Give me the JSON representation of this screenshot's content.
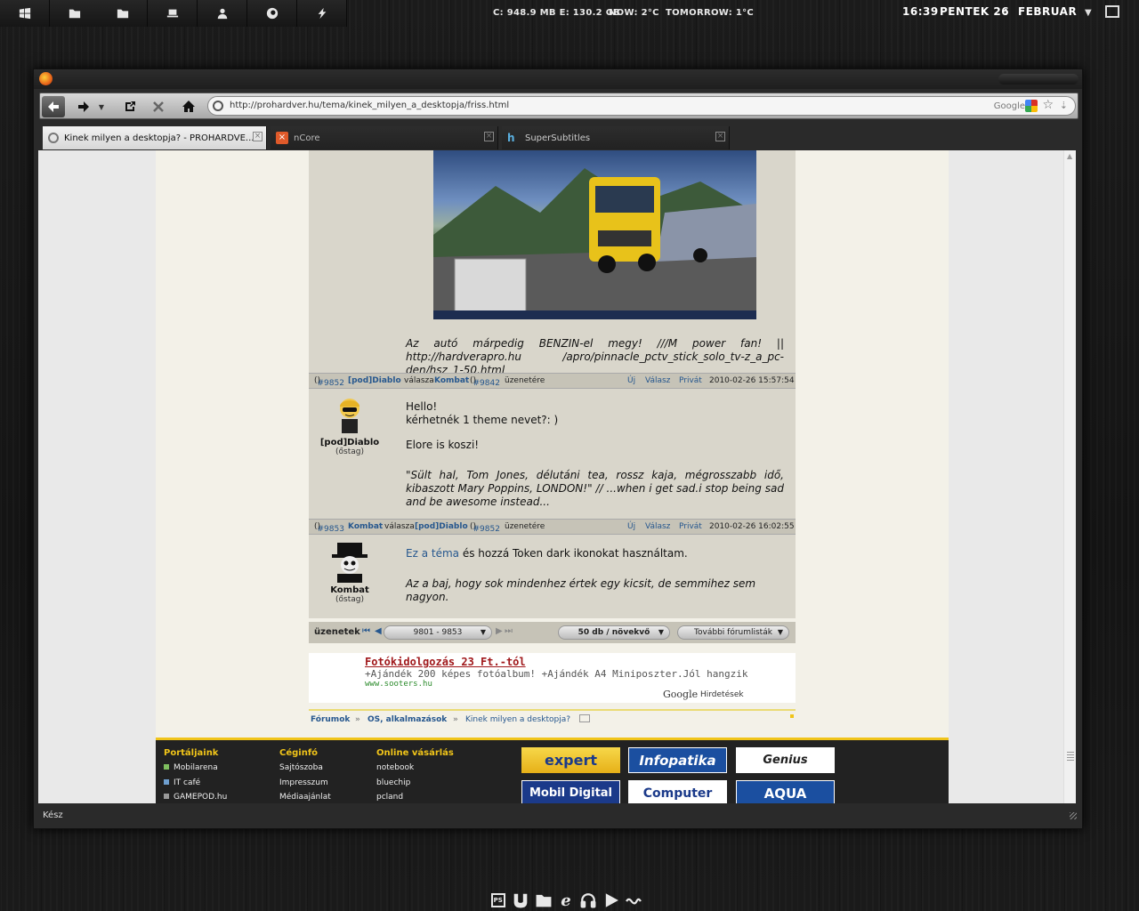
{
  "panel": {
    "stats": "C: 948.9 MB  E: 130.2 GB",
    "weather_now": "NOW:  2°C",
    "weather_tomorrow": "TOMORROW:      1°C",
    "time": "16:39",
    "day": "PENTEK 26",
    "separator": ":",
    "month": "FEBRUAR"
  },
  "browser": {
    "url": "http://prohardver.hu/tema/kinek_milyen_a_desktopja/friss.html",
    "search_engine": "Google",
    "tabs": [
      {
        "label": "Kinek milyen a desktopja? - PROHARDVE..."
      },
      {
        "label": "nCore"
      },
      {
        "label": "SuperSubtitles"
      }
    ],
    "new_tab": "+",
    "status": "Kész"
  },
  "forum": {
    "post1_sig": "Az autó márpedig BENZIN-el megy! ///M power fan! || http://hardverapro.hu /apro/pinnacle_pctv_stick_solo_tv-z_a_pc-den/hsz_1-50.html",
    "post2": {
      "id": "#9852",
      "author": "[pod]Diablo",
      "replyword": "válasza",
      "target": "Kombat",
      "target_id": "#9842",
      "suffix": "üzenetére",
      "actions": [
        "Új",
        "Válasz",
        "Privát"
      ],
      "date": "2010-02-26 15:57:54",
      "nick": "[pod]Diablo",
      "rank": "(őstag)",
      "line1": "Hello!",
      "line2": "kérhetnék 1 theme nevet?: )",
      "line3": "Elore is koszi!",
      "sig": "\"Sült hal, Tom Jones, délutáni tea, rossz kaja, mégrosszabb idő, kibaszott Mary Poppins, LONDON!\" // ...when i get sad.i stop being sad and be awesome instead..."
    },
    "post3": {
      "id": "#9853",
      "author": "Kombat",
      "replyword": "válasza",
      "target": "[pod]Diablo",
      "target_id": "#9852",
      "suffix": "üzenetére",
      "actions": [
        "Új",
        "Válasz",
        "Privát"
      ],
      "date": "2010-02-26 16:02:55",
      "nick": "Kombat",
      "rank": "(őstag)",
      "link_text": "Ez a téma",
      "line1_rest": "és hozzá Token dark ikonokat használtam.",
      "sig": "Az a baj, hogy sok mindenhez értek egy kicsit, de semmihez sem nagyon."
    },
    "pager": {
      "label": "üzenetek",
      "range": "9801 - 9853",
      "count": "50 db / növekvő",
      "lists": "További fórumlisták"
    },
    "ad": {
      "title": "Fotókidolgozás 23 Ft.-tól",
      "text": "+Ajándék 200 képes fotóalbum! +Ajándék A4 Miniposzter.Jól hangzik",
      "url": "www.sooters.hu",
      "brand": "Google",
      "brand_suffix": "Hirdetések"
    },
    "breadcrumb": [
      "Fórumok",
      "OS, alkalmazások",
      "Kinek milyen a desktopja?"
    ],
    "breadcrumb_sep": "»"
  },
  "footer": {
    "col1_title": "Portáljaink",
    "col1": [
      "Mobilarena",
      "IT café",
      "GAMEPOD.hu"
    ],
    "col2_title": "Céginfó",
    "col2": [
      "Sajtószoba",
      "Impresszum",
      "Médiaajánlat"
    ],
    "col3_title": "Online vásárlás",
    "col3": [
      "notebook",
      "bluechip",
      "pcland"
    ],
    "logos": [
      "expert computer",
      "Infopatika",
      "Genius",
      "Mobil Digital",
      "Computer Emporium",
      "AQUA electronics"
    ],
    "logo_texts": {
      "expert": "expert",
      "infopatika": "Infopatika",
      "genius": "Genius",
      "mobil": "Mobil Digital",
      "computer": "Computer",
      "aqua": "AQUA"
    },
    "colors": {
      "mobilarena": "#7fbf5f",
      "itcafe": "#6f9fcf",
      "gamepod": "#999999",
      "accent": "#f0c419"
    }
  },
  "dock": {
    "ps_label": "PS",
    "icons": [
      "photoshop-icon",
      "utorrent-icon",
      "folder-icon",
      "ie-icon",
      "headphones-icon",
      "play-icon",
      "link-icon"
    ]
  }
}
